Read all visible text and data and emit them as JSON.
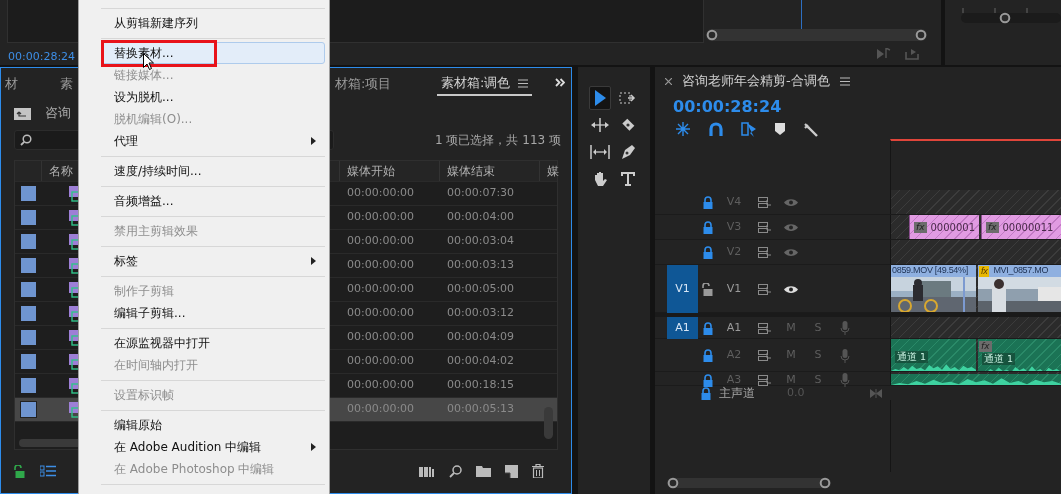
{
  "source_monitor": {
    "timecode": "00:00:28:24"
  },
  "project_panel": {
    "tabs": [
      {
        "label": "材",
        "selected": false
      },
      {
        "label": "素",
        "selected": false
      },
      {
        "label": "材箱:项目",
        "selected": false
      },
      {
        "label": "素材箱:调色",
        "selected": true
      }
    ],
    "breadcrumb": "咨询",
    "selection_count": "1 项已选择，共 113 项",
    "columns": [
      "名称",
      "媒体开始",
      "媒体结束",
      "媒"
    ],
    "rows": [
      {
        "start": "00:00:00:00",
        "end": "00:00:07:30",
        "selected": false
      },
      {
        "start": "00:00:00:00",
        "end": "00:00:04:00",
        "selected": false
      },
      {
        "start": "00:00:00:00",
        "end": "00:00:03:04",
        "selected": false
      },
      {
        "start": "00:00:00:00",
        "end": "00:00:03:13",
        "selected": false
      },
      {
        "start": "00:00:00:00",
        "end": "00:00:05:00",
        "selected": false
      },
      {
        "start": "00:00:00:00",
        "end": "00:00:03:12",
        "selected": false
      },
      {
        "start": "00:00:00:00",
        "end": "00:00:04:09",
        "selected": false
      },
      {
        "start": "00:00:00:00",
        "end": "00:00:04:02",
        "selected": false
      },
      {
        "start": "00:00:00:00",
        "end": "00:00:18:15",
        "selected": false
      },
      {
        "start": "00:00:00:00",
        "end": "00:00:05:13",
        "selected": true
      }
    ]
  },
  "context_menu": {
    "items": [
      {
        "kind": "separator"
      },
      {
        "kind": "item",
        "label": "从剪辑新建序列",
        "disabled": false,
        "selected": false,
        "submenu": false,
        "annotated": false
      },
      {
        "kind": "separator"
      },
      {
        "kind": "item",
        "label": "替换素材...",
        "disabled": false,
        "selected": true,
        "submenu": false,
        "annotated": true
      },
      {
        "kind": "item",
        "label": "链接媒体...",
        "disabled": true,
        "selected": false,
        "submenu": false,
        "annotated": false
      },
      {
        "kind": "item",
        "label": "设为脱机...",
        "disabled": false,
        "selected": false,
        "submenu": false,
        "annotated": false
      },
      {
        "kind": "item",
        "label": "脱机编辑(O)...",
        "disabled": true,
        "selected": false,
        "submenu": false,
        "annotated": false
      },
      {
        "kind": "item",
        "label": "代理",
        "disabled": false,
        "selected": false,
        "submenu": true,
        "annotated": false
      },
      {
        "kind": "separator"
      },
      {
        "kind": "item",
        "label": "速度/持续时间...",
        "disabled": false,
        "selected": false,
        "submenu": false,
        "annotated": false
      },
      {
        "kind": "separator"
      },
      {
        "kind": "item",
        "label": "音频增益...",
        "disabled": false,
        "selected": false,
        "submenu": false,
        "annotated": false
      },
      {
        "kind": "separator"
      },
      {
        "kind": "item",
        "label": "禁用主剪辑效果",
        "disabled": true,
        "selected": false,
        "submenu": false,
        "annotated": false
      },
      {
        "kind": "separator"
      },
      {
        "kind": "item",
        "label": "标签",
        "disabled": false,
        "selected": false,
        "submenu": true,
        "annotated": false
      },
      {
        "kind": "separator"
      },
      {
        "kind": "item",
        "label": "制作子剪辑",
        "disabled": true,
        "selected": false,
        "submenu": false,
        "annotated": false
      },
      {
        "kind": "item",
        "label": "编辑子剪辑...",
        "disabled": false,
        "selected": false,
        "submenu": false,
        "annotated": false
      },
      {
        "kind": "separator"
      },
      {
        "kind": "item",
        "label": "在源监视器中打开",
        "disabled": false,
        "selected": false,
        "submenu": false,
        "annotated": false
      },
      {
        "kind": "item",
        "label": "在时间轴内打开",
        "disabled": true,
        "selected": false,
        "submenu": false,
        "annotated": false
      },
      {
        "kind": "separator"
      },
      {
        "kind": "item",
        "label": "设置标识帧",
        "disabled": true,
        "selected": false,
        "submenu": false,
        "annotated": false
      },
      {
        "kind": "separator"
      },
      {
        "kind": "item",
        "label": "编辑原始",
        "disabled": false,
        "selected": false,
        "submenu": false,
        "annotated": false
      },
      {
        "kind": "item",
        "label": "在 Adobe Audition 中编辑",
        "disabled": false,
        "selected": false,
        "submenu": true,
        "annotated": false
      },
      {
        "kind": "item",
        "label": "在 Adobe Photoshop 中编辑",
        "disabled": true,
        "selected": false,
        "submenu": false,
        "annotated": false
      },
      {
        "kind": "separator"
      }
    ]
  },
  "timeline": {
    "title": "咨询老师年会精剪-合调色",
    "timecode": "00:00:28:24",
    "video_tracks": [
      {
        "name": "V4",
        "locked": true
      },
      {
        "name": "V3",
        "locked": true,
        "clips": [
          {
            "kind": "graphic",
            "label": "0000001",
            "fx_badge": "fx"
          },
          {
            "kind": "graphic",
            "label": "00000011",
            "fx_badge": "fx"
          }
        ]
      },
      {
        "name": "V2",
        "locked": true
      },
      {
        "name": "V1",
        "locked": false,
        "source_patch": "V1",
        "clips": [
          {
            "kind": "video",
            "label": "0859.MOV [49.54%]"
          },
          {
            "kind": "video",
            "label": "MVI_0857.MO",
            "fx_badge": "fx"
          }
        ]
      }
    ],
    "audio_tracks": [
      {
        "name": "A1",
        "locked": true,
        "source_patch": "A1",
        "mute": "M",
        "solo": "S"
      },
      {
        "name": "A2",
        "locked": true,
        "mute": "M",
        "solo": "S",
        "clips": [
          {
            "kind": "audio",
            "label": "通道 1"
          },
          {
            "kind": "audio",
            "label": "通道 1",
            "fx_badge": "fx"
          }
        ]
      },
      {
        "name": "A3",
        "locked": true,
        "mute": "M",
        "solo": "S",
        "clips": [
          {
            "kind": "audio"
          }
        ]
      }
    ],
    "master": {
      "name": "主声道",
      "value": "0.0",
      "locked": true
    }
  }
}
